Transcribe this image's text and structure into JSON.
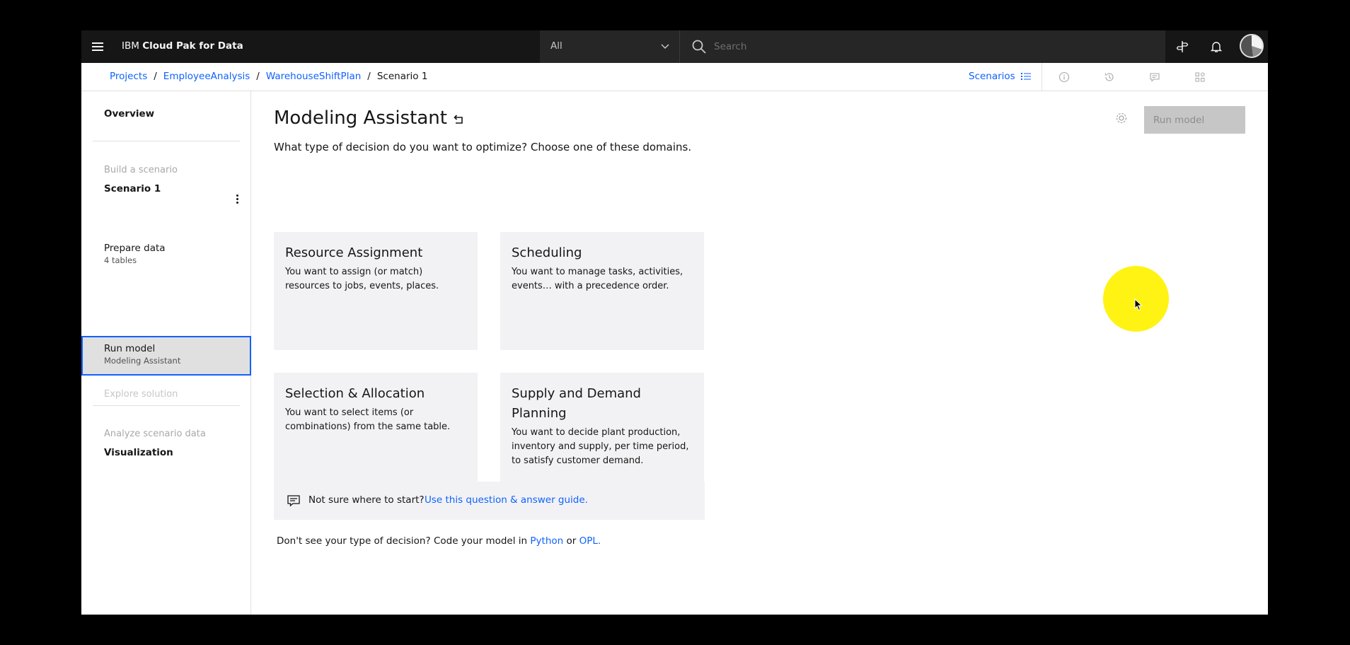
{
  "header": {
    "brand_prefix": "IBM",
    "brand_name": "Cloud Pak for Data",
    "scope_value": "All",
    "search_placeholder": "Search"
  },
  "breadcrumb": {
    "items": [
      "Projects",
      "EmployeeAnalysis",
      "WarehouseShiftPlan"
    ],
    "current": "Scenario 1",
    "scenarios_label": "Scenarios"
  },
  "sidebar": {
    "overview": "Overview",
    "build_label": "Build a scenario",
    "scenario_name": "Scenario 1",
    "prepare": {
      "title": "Prepare data",
      "sub": "4 tables"
    },
    "run": {
      "title": "Run model",
      "sub": "Modeling Assistant"
    },
    "explore": "Explore solution",
    "analyze_label": "Analyze scenario data",
    "visualization": "Visualization"
  },
  "main": {
    "title": "Modeling Assistant",
    "subtitle": "What type of decision do you want to optimize? Choose one of these domains.",
    "run_button": "Run model",
    "cards": [
      {
        "title": "Resource Assignment",
        "desc": "You want to assign (or match) resources to jobs, events, places."
      },
      {
        "title": "Scheduling",
        "desc": "You want to manage tasks, activities, events… with a precedence order."
      },
      {
        "title": "Selection & Allocation",
        "desc": "You want to select items (or combinations) from the same table."
      },
      {
        "title": "Supply and Demand Planning",
        "desc": "You want to decide plant production, inventory and supply, per time period, to satisfy customer demand."
      }
    ],
    "help_text": "Not sure where to start?",
    "help_link": "Use this question & answer guide.",
    "code_prefix": "Don't see your type of decision? Code your model in",
    "code_python": "Python",
    "code_or": "or",
    "code_opl": "OPL."
  },
  "colors": {
    "header_bg": "#161616",
    "link": "#0f62fe",
    "card_bg": "#f2f2f4",
    "selected_nav": "#e0e0e0",
    "cursor_highlight": "#fff200"
  }
}
